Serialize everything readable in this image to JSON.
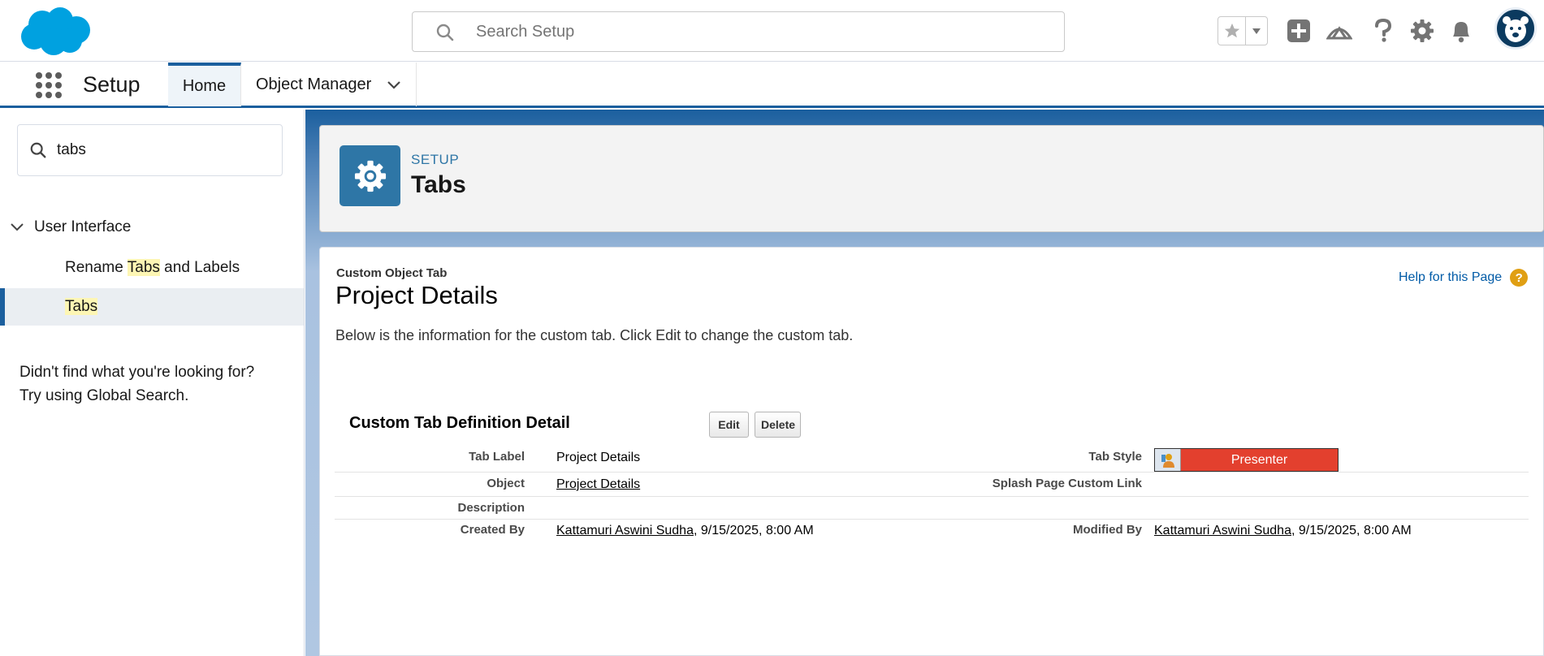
{
  "header": {
    "search_placeholder": "Search Setup",
    "icons": [
      "salesforce-cloud-logo",
      "favorites-star-icon",
      "favorites-dropdown-icon",
      "global-actions-plus-icon",
      "trailhead-icon",
      "help-question-icon",
      "setup-gear-icon",
      "notifications-bell-icon",
      "user-avatar"
    ]
  },
  "nav": {
    "app_name": "Setup",
    "tabs": [
      {
        "label": "Home"
      },
      {
        "label": "Object Manager"
      }
    ]
  },
  "sidebar": {
    "quickfind_value": "tabs",
    "section_label": "User Interface",
    "items": [
      {
        "prefix": "Rename ",
        "highlight": "Tabs",
        "suffix": " and Labels"
      },
      {
        "prefix": "",
        "highlight": "Tabs",
        "suffix": ""
      }
    ],
    "not_found_line1": "Didn't find what you're looking for?",
    "not_found_line2": "Try using Global Search."
  },
  "page_header": {
    "eyebrow": "SETUP",
    "title": "Tabs"
  },
  "content": {
    "type_label": "Custom Object Tab",
    "title": "Project Details",
    "help_link": "Help for this Page",
    "description": "Below is the information for the custom tab. Click Edit to change the custom tab.",
    "detail_title": "Custom Tab Definition Detail",
    "edit_label": "Edit",
    "delete_label": "Delete",
    "rows": {
      "tab_label": {
        "label": "Tab Label",
        "value": "Project Details"
      },
      "tab_style": {
        "label": "Tab Style",
        "value": "Presenter",
        "color": "#e3402e"
      },
      "object": {
        "label": "Object",
        "value": "Project Details"
      },
      "splash": {
        "label": "Splash Page Custom Link",
        "value": ""
      },
      "description": {
        "label": "Description",
        "value": ""
      },
      "created_by": {
        "label": "Created By",
        "user": "Kattamuri Aswini Sudha",
        "date": ", 9/15/2025, 8:00 AM"
      },
      "modified_by": {
        "label": "Modified By",
        "user": "Kattamuri Aswini Sudha",
        "date": ", 9/15/2025, 8:00 AM"
      }
    }
  },
  "colors": {
    "brand": "#1b5f9e",
    "setup_icon": "#2e76a6",
    "salesforce_blue": "#00a1e0",
    "highlight": "#fdf6b4"
  }
}
